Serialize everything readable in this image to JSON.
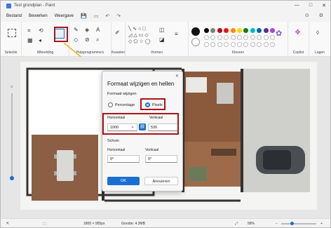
{
  "window": {
    "title": "Test grondplan - Paint",
    "minimize": "—",
    "maximize": "□",
    "close": "✕"
  },
  "menu": {
    "items": [
      "Bestand",
      "Bewerken",
      "Weergave"
    ],
    "quick": [
      "💾",
      "▭",
      "↶",
      "↷"
    ],
    "right": [
      "⊙",
      "⚙"
    ]
  },
  "ribbon": {
    "groups": [
      "Selectie",
      "Afbeelding",
      "Hulpprogramma's",
      "Kwasten",
      "Vormen",
      "Kleuren",
      "Copilot",
      "Lagen"
    ]
  },
  "colors": {
    "row1": [
      "#000000",
      "#7f7f7f",
      "#c00000",
      "#e81123",
      "#ff8c00",
      "#ffd700",
      "#107c10",
      "#00b7c3",
      "#0063b1",
      "#5c2d91",
      "#b146c2"
    ],
    "accent": "#1a6fd0",
    "highlight": "#a8141b"
  },
  "dialog": {
    "close": "✕",
    "title": "Formaat wijzigen en hellen",
    "resize_heading": "Formaat wijzigen",
    "option_percentage": "Percentage",
    "option_pixels": "Pixels",
    "horizontal_label": "Horizontaal",
    "vertical_label": "Verticaal",
    "horizontal_value": "1000",
    "vertical_value": "530",
    "clear": "✕",
    "link_icon": "⛓",
    "skew_heading": "Schuin",
    "skew_horizontal_label": "Horizontaal",
    "skew_vertical_label": "Verticaal",
    "skew_horizontal_value": "0°",
    "skew_vertical_value": "0°",
    "ok": "OK",
    "cancel": "Annuleren"
  },
  "status": {
    "pointer": "⇱",
    "selection": "⬚",
    "dimensions": "1800 × 955px",
    "size": "Grootte: 4.3MB",
    "fit_icon": "⤢",
    "zoom": "58%",
    "zoom_out": "−",
    "zoom_in": "+",
    "zoom_level": 0.3
  }
}
